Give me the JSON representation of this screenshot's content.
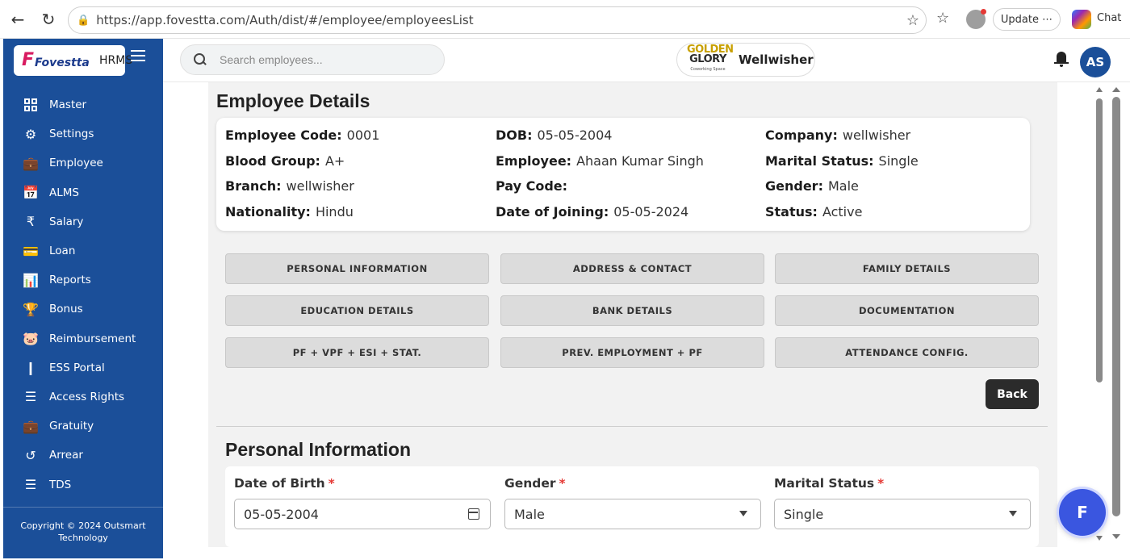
{
  "browser": {
    "url": "https://app.fovestta.com/Auth/dist/#/employee/employeesList",
    "update_label": "Update",
    "chat_label": "Chat"
  },
  "sidebar": {
    "logo_text": "Fovestta",
    "logo_product": "HRMS",
    "items": [
      {
        "label": "Master",
        "icon": "grid-icon"
      },
      {
        "label": "Settings",
        "icon": "gear-icon"
      },
      {
        "label": "Employee",
        "icon": "id-badge-icon"
      },
      {
        "label": "ALMS",
        "icon": "calendar-icon"
      },
      {
        "label": "Salary",
        "icon": "rupee-icon"
      },
      {
        "label": "Loan",
        "icon": "wallet-icon"
      },
      {
        "label": "Reports",
        "icon": "report-chart-icon"
      },
      {
        "label": "Bonus",
        "icon": "trophy-icon"
      },
      {
        "label": "Reimbursement",
        "icon": "piggy-bank-icon"
      },
      {
        "label": "ESS Portal",
        "icon": "person-icon"
      },
      {
        "label": "Access Rights",
        "icon": "list-icon"
      },
      {
        "label": "Gratuity",
        "icon": "briefcase-icon"
      },
      {
        "label": "Arrear",
        "icon": "history-icon"
      },
      {
        "label": "TDS",
        "icon": "list-icon"
      }
    ],
    "copyright_line1": "Copyright © 2024 Outsmart",
    "copyright_line2": "Technology"
  },
  "header": {
    "search_placeholder": "Search employees...",
    "brand_logo_line1": "GOLDEN",
    "brand_logo_line2": "GLORY",
    "brand_logo_sub": "Coworking Space",
    "brand_name": "Wellwisher",
    "avatar_initials": "AS"
  },
  "employee_details": {
    "title": "Employee Details",
    "fields": [
      {
        "label": "Employee Code:",
        "value": "0001"
      },
      {
        "label": "DOB:",
        "value": "05-05-2004"
      },
      {
        "label": "Company:",
        "value": "wellwisher"
      },
      {
        "label": "Blood Group:",
        "value": "A+"
      },
      {
        "label": "Employee:",
        "value": "Ahaan Kumar Singh"
      },
      {
        "label": "Marital Status:",
        "value": "Single"
      },
      {
        "label": "Branch:",
        "value": "wellwisher"
      },
      {
        "label": "Pay Code:",
        "value": ""
      },
      {
        "label": "Gender:",
        "value": "Male"
      },
      {
        "label": "Nationality:",
        "value": "Hindu"
      },
      {
        "label": "Date of Joining:",
        "value": "05-05-2024"
      },
      {
        "label": "Status:",
        "value": "Active"
      }
    ]
  },
  "tabs": [
    "PERSONAL INFORMATION",
    "ADDRESS & CONTACT",
    "FAMILY DETAILS",
    "EDUCATION DETAILS",
    "BANK DETAILS",
    "DOCUMENTATION",
    "PF + VPF + ESI + STAT.",
    "PREV. EMPLOYMENT + PF",
    "ATTENDANCE CONFIG."
  ],
  "back_label": "Back",
  "personal_info": {
    "title": "Personal Information",
    "dob_label": "Date of Birth",
    "dob_value": "05-05-2004",
    "gender_label": "Gender",
    "gender_value": "Male",
    "marital_label": "Marital Status",
    "marital_value": "Single",
    "required_mark": "*"
  },
  "fab_label": "F"
}
